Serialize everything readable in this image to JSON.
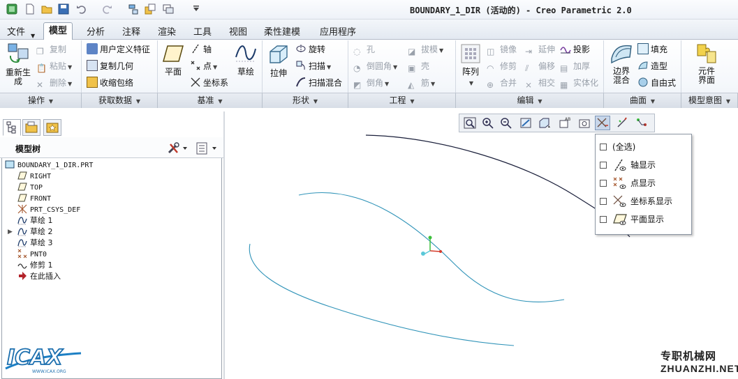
{
  "window": {
    "title": "BOUNDARY_1_DIR (活动的) - Creo Parametric 2.0"
  },
  "tabs": [
    "文件",
    "模型",
    "分析",
    "注释",
    "渲染",
    "工具",
    "视图",
    "柔性建模",
    "应用程序"
  ],
  "active_tab": "模型",
  "ribbon": {
    "operations": {
      "regenerate": "重新生\n成",
      "copy": "复制",
      "paste": "粘贴",
      "delete": "删除",
      "group": "操作"
    },
    "get_data": {
      "udf": "用户定义特征",
      "copy_geom": "复制几何",
      "shrinkwrap": "收缩包络",
      "group": "获取数据"
    },
    "datum": {
      "plane": "平面",
      "axis": "轴",
      "point": "点",
      "csys": "坐标系",
      "sketch": "草绘",
      "group": "基准"
    },
    "shapes": {
      "extrude": "拉伸",
      "revolve": "旋转",
      "sweep": "扫描",
      "swept_blend": "扫描混合",
      "group": "形状"
    },
    "engineering": {
      "hole": "孔",
      "round": "倒圆角",
      "chamfer": "倒角",
      "draft": "拔模",
      "shell": "壳",
      "rib": "筋",
      "group": "工程"
    },
    "editing": {
      "pattern": "阵列",
      "mirror": "镜像",
      "trim": "修剪",
      "merge": "合并",
      "extend": "延伸",
      "offset": "偏移",
      "intersect": "相交",
      "project": "投影",
      "thicken": "加厚",
      "solidify": "实体化",
      "group": "编辑"
    },
    "surfaces": {
      "boundary_blend": "边界\n混合",
      "fill": "填充",
      "style": "造型",
      "freestyle": "自由式",
      "group": "曲面"
    },
    "model_intent": {
      "component_interface": "元件\n界面",
      "group": "模型意图"
    }
  },
  "model_tree": {
    "title": "模型树",
    "items": [
      {
        "label": "BOUNDARY_1_DIR.PRT",
        "icon": "part-icon",
        "indent": 0
      },
      {
        "label": "RIGHT",
        "icon": "datum-plane-icon",
        "indent": 1
      },
      {
        "label": "TOP",
        "icon": "datum-plane-icon",
        "indent": 1
      },
      {
        "label": "FRONT",
        "icon": "datum-plane-icon",
        "indent": 1
      },
      {
        "label": "PRT_CSYS_DEF",
        "icon": "csys-icon",
        "indent": 1
      },
      {
        "label": "草绘 1",
        "icon": "sketch-icon",
        "indent": 1
      },
      {
        "label": "草绘 2",
        "icon": "sketch-icon",
        "indent": 1,
        "expandable": true
      },
      {
        "label": "草绘 3",
        "icon": "sketch-icon",
        "indent": 1
      },
      {
        "label": "PNT0",
        "icon": "datum-point-icon",
        "indent": 1
      },
      {
        "label": "修剪 1",
        "icon": "trim-icon",
        "indent": 1
      },
      {
        "label": "在此插入",
        "icon": "insert-here-icon",
        "indent": 1
      }
    ]
  },
  "datum_display_menu": {
    "items": [
      {
        "label": "(全选)",
        "checked": false
      },
      {
        "label": "轴显示",
        "checked": false,
        "icon": "axis-display-icon"
      },
      {
        "label": "点显示",
        "checked": false,
        "icon": "point-display-icon"
      },
      {
        "label": "坐标系显示",
        "checked": false,
        "icon": "csys-display-icon"
      },
      {
        "label": "平面显示",
        "checked": false,
        "icon": "plane-display-icon"
      }
    ]
  },
  "watermark": {
    "cn": "专职机械网",
    "url": "ZHUANZHI.NET",
    "logo": "ICAX",
    "logo_sub": "WWW.ICAX.ORG"
  },
  "colors": {
    "accent": "#2b6cb3",
    "curve_cyan": "#2f93b8",
    "curve_dark": "#1a1f3a"
  }
}
